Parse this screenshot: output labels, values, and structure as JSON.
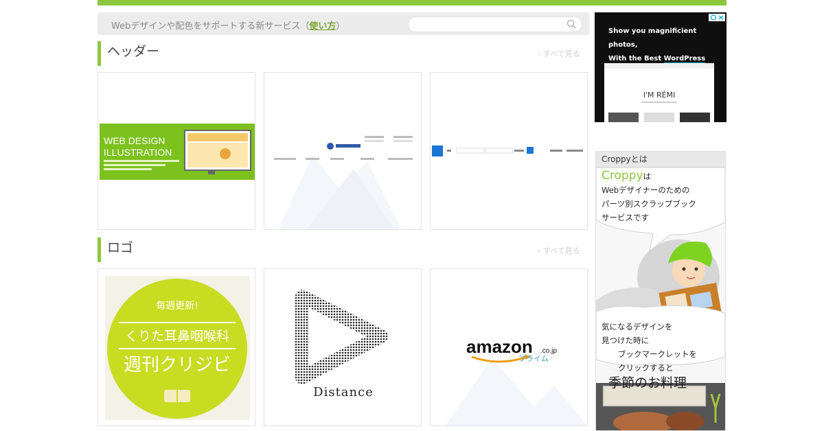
{
  "infobar": {
    "text": "Webデザインや配色をサポートする新サービス（",
    "link": "使い方",
    "text_end": "）",
    "search_placeholder": ""
  },
  "sections": [
    {
      "title": "ヘッダー",
      "see_all": "› すべて見る",
      "cards": [
        {
          "name": "header-thumb-web-design-illustration",
          "big1": "WEB DESIGN",
          "big2": "ILLUSTRATION"
        },
        {
          "name": "header-thumb-nav-menu"
        },
        {
          "name": "header-thumb-blue-search-bar"
        }
      ]
    },
    {
      "title": "ロゴ",
      "see_all": "› すべて見る",
      "cards": [
        {
          "name": "logo-thumb-kurita",
          "line1": "毎週更新!",
          "line2": "くりた耳鼻咽喉科",
          "line3": "週刊クリジビ"
        },
        {
          "name": "logo-thumb-distance",
          "text": "Distance"
        },
        {
          "name": "logo-thumb-amazon",
          "word": "amazon",
          "suffix": ".co.jp",
          "sub": "プライム"
        }
      ]
    }
  ],
  "ad": {
    "line1": "Show you magnificient photos,",
    "line2_pre": "With the Best ",
    "line2_u": "WordPress Theme",
    "line2_post": ".",
    "screenshot_title": "I'M RÉMI"
  },
  "croppy": {
    "header": "Croppyとは",
    "brand": "Croppy",
    "brand_suffix": "は",
    "line2": "Webデザイナーのための",
    "line3": "パーツ別スクラップブック",
    "line4": "サービスです",
    "bubble2_line1": "気になるデザインを",
    "bubble2_line2": "見つけた時に",
    "bubble2_line3": "ブックマークレットを",
    "bubble2_line4": "クリックすると",
    "bottom_label": "季節のお料理"
  },
  "colors": {
    "accent": "#8cc63f",
    "link": "#7aa52e"
  }
}
